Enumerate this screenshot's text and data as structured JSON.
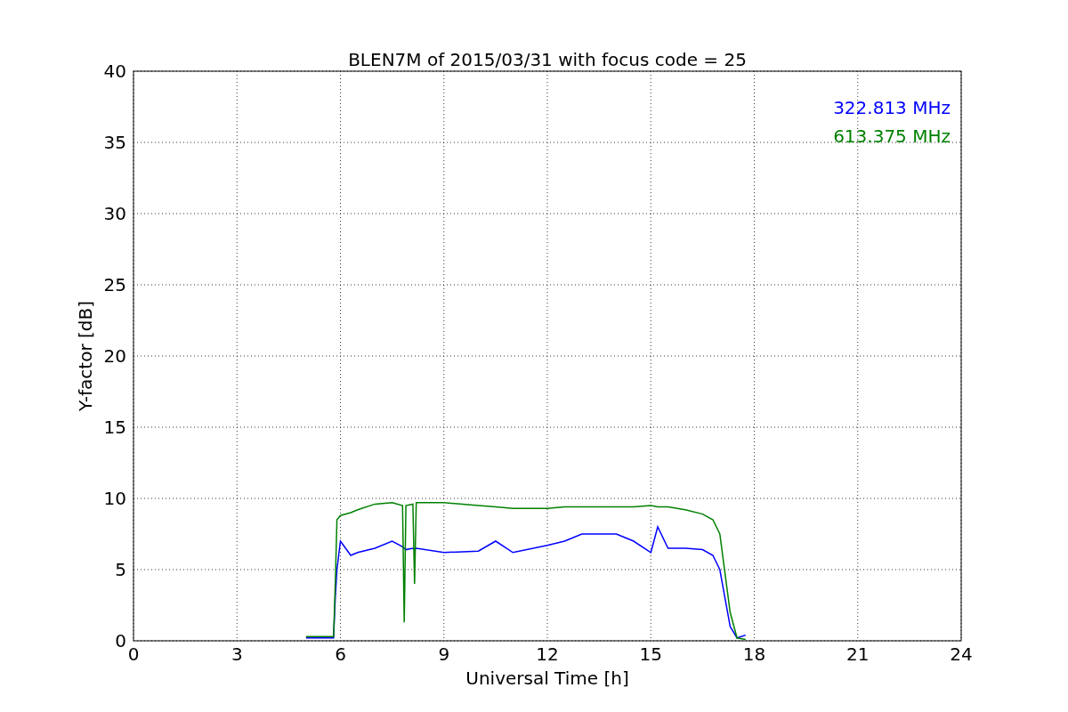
{
  "figure": {
    "chart_data": {
      "type": "line",
      "grid": true,
      "title": "BLEN7M of 2015/03/31 with focus code = 25",
      "xlabel": "Universal Time [h]",
      "ylabel": "Y-factor [dB]",
      "xlim": [
        0,
        24
      ],
      "ylim": [
        0,
        40
      ],
      "xticks": [
        0,
        3,
        6,
        9,
        12,
        15,
        18,
        21,
        24
      ],
      "yticks": [
        0,
        5,
        10,
        15,
        20,
        25,
        30,
        35,
        40
      ],
      "x": [
        5,
        5.8,
        5.85,
        5.9,
        6,
        6.3,
        6.5,
        7,
        7.5,
        7.8,
        7.85,
        7.9,
        8.1,
        8.15,
        8.2,
        9,
        10,
        10.5,
        11,
        12,
        12.5,
        13,
        14,
        14.5,
        15,
        15.2,
        15.5,
        16,
        16.5,
        16.8,
        17,
        17.3,
        17.5,
        17.75
      ],
      "series": [
        {
          "name": "322.813 MHz",
          "color": "#0000ff",
          "values": [
            0.2,
            0.2,
            3,
            5,
            7,
            6,
            6.2,
            6.5,
            7,
            6.6,
            6.5,
            6.4,
            6.5,
            6.4,
            6.5,
            6.2,
            6.3,
            7,
            6.2,
            6.7,
            7,
            7.5,
            7.5,
            7,
            6.2,
            8,
            6.5,
            6.5,
            6.4,
            6,
            5,
            1,
            0.2,
            0.4
          ]
        },
        {
          "name": "613.375 MHz",
          "color": "#008000",
          "values": [
            0.3,
            0.3,
            4,
            8.5,
            8.8,
            9,
            9.2,
            9.6,
            9.7,
            9.5,
            1.3,
            9.5,
            9.6,
            4,
            9.7,
            9.7,
            9.5,
            9.4,
            9.3,
            9.3,
            9.4,
            9.4,
            9.4,
            9.4,
            9.5,
            9.4,
            9.4,
            9.2,
            8.9,
            8.5,
            7.5,
            2,
            0.2,
            0.1
          ]
        }
      ]
    }
  }
}
